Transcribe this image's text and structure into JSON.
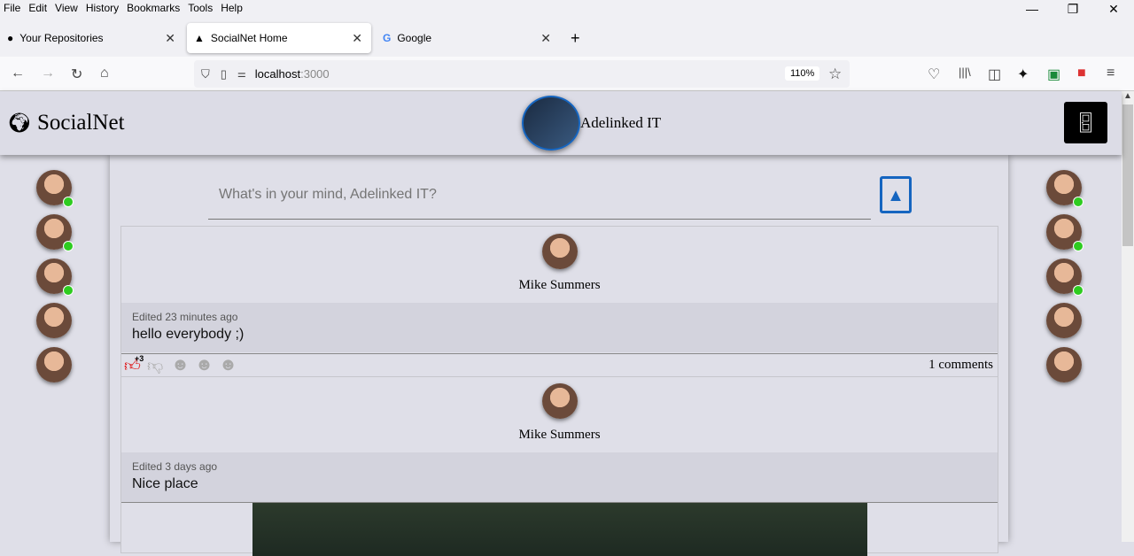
{
  "menu": [
    "File",
    "Edit",
    "View",
    "History",
    "Bookmarks",
    "Tools",
    "Help"
  ],
  "tabs": [
    {
      "label": "Your Repositories",
      "icon": "github-icon"
    },
    {
      "label": "SocialNet Home",
      "icon": "socialnet-icon"
    },
    {
      "label": "Google",
      "icon": "google-icon"
    }
  ],
  "url": {
    "host": "localhost",
    "port": ":3000",
    "zoom": "110%"
  },
  "app": {
    "logo": "SocialNet",
    "user": "Adelinked IT"
  },
  "composer": {
    "placeholder": "What's in your mind, Adelinked IT?"
  },
  "left_friends": [
    {
      "online": true
    },
    {
      "online": true
    },
    {
      "online": true
    },
    {
      "online": false
    },
    {
      "online": false
    }
  ],
  "right_friends": [
    {
      "online": true
    },
    {
      "online": true
    },
    {
      "online": true
    },
    {
      "online": false
    },
    {
      "online": false
    }
  ],
  "posts": [
    {
      "author": "Mike Summers",
      "edited": "Edited 23 minutes ago",
      "content": "hello everybody ;)",
      "like_count": "+3",
      "comments": "1 comments"
    },
    {
      "author": "Mike Summers",
      "edited": "Edited 3 days ago",
      "content": "Nice place"
    }
  ],
  "colors": {
    "online": "#2ecc20",
    "like": "#e00000",
    "accent": "#1565c0"
  }
}
